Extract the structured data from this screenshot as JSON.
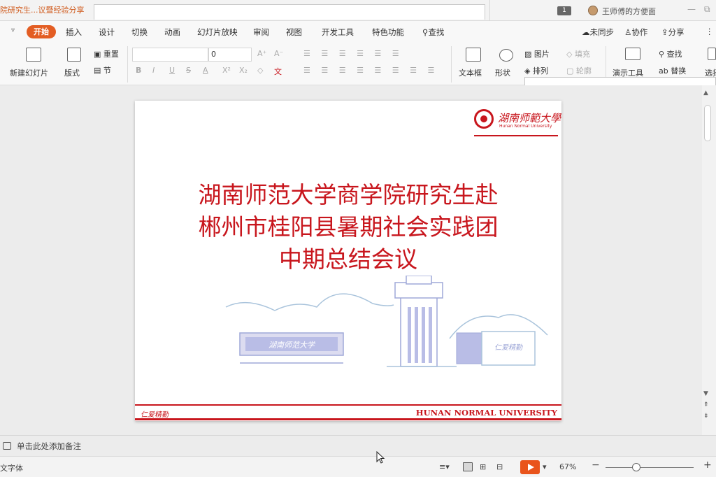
{
  "titlebar": {
    "doc_tab": "院研究生...议暨经验分享",
    "page_badge": "1",
    "user_name": "王师傅的方便面",
    "minimize": "—",
    "restore": "⧉"
  },
  "menu": {
    "dropdown": "▿",
    "start": "开始",
    "items": [
      "插入",
      "设计",
      "切换",
      "动画",
      "幻灯片放映",
      "审阅",
      "视图",
      "开发工具",
      "特色功能"
    ],
    "search": "查找",
    "sync": "未同步",
    "collab": "协作",
    "share": "分享",
    "more": "⋮"
  },
  "ribbon": {
    "new_slide": "新建幻灯片",
    "layout": "版式",
    "reset": "重置",
    "section": "节",
    "font_size": "0",
    "font_grow": "A⁺",
    "font_shrink": "A⁻",
    "bold": "B",
    "italic": "I",
    "underline": "U",
    "strike": "S",
    "font_color": "A",
    "superscript": "X²",
    "subscript": "X₂",
    "clear": "◇",
    "pinyin": "文",
    "textbox": "文本框",
    "shape": "形状",
    "picture": "图片",
    "arrange": "排列",
    "fill": "填充",
    "outline": "轮廓",
    "present_tools": "演示工具",
    "find": "查找",
    "replace": "替换",
    "select": "选择"
  },
  "slide": {
    "logo_cn": "湖南师範大學",
    "logo_en": "Hunan Normal University",
    "title_line1": "湖南师范大学商学院研究生赴",
    "title_line2": "郴州市桂阳县暑期社会实践团",
    "title_line3": "中期总结会议",
    "footer_left": "仁爱精勤",
    "footer_right": "HUNAN NORMAL UNIVERSITY",
    "illus_sign_text": "湖南师范大学",
    "illus_sign2_text": "仁爱精勤"
  },
  "notes": {
    "placeholder": "单击此处添加备注"
  },
  "statusbar": {
    "left_text": "文字体",
    "zoom": "67%",
    "zoom_minus": "−",
    "zoom_plus": "+",
    "zoom_level": 0.35
  },
  "colors": {
    "accent": "#e35d23",
    "brand_red": "#c8161d"
  }
}
